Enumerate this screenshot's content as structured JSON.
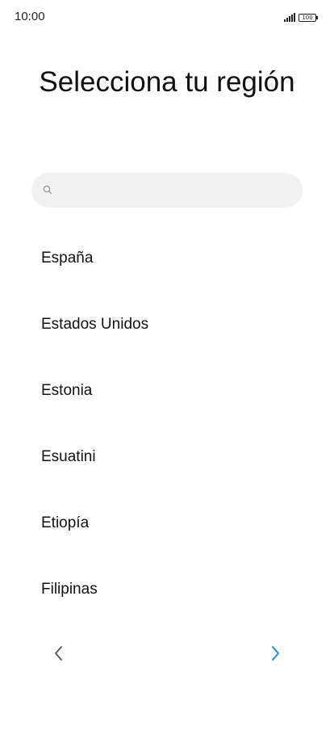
{
  "status_bar": {
    "time": "10:00",
    "battery_level": "100",
    "icons": [
      "signal-icon",
      "battery-icon"
    ]
  },
  "title": "Selecciona tu región",
  "search": {
    "placeholder": "",
    "value": "",
    "icon": "search-icon"
  },
  "regions": [
    {
      "label": "España"
    },
    {
      "label": "Estados Unidos"
    },
    {
      "label": "Estonia"
    },
    {
      "label": "Esuatini"
    },
    {
      "label": "Etiopía"
    },
    {
      "label": "Filipinas"
    }
  ],
  "navigation": {
    "back_icon": "chevron-left-icon",
    "next_icon": "chevron-right-icon",
    "back_color": "#555555",
    "next_color": "#1a8ed8"
  }
}
